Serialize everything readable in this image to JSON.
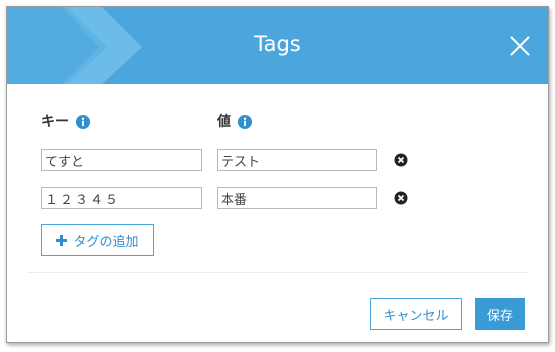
{
  "dialog": {
    "title": "Tags",
    "close_icon": "close-icon",
    "accent_color": "#4aa6dd"
  },
  "columns": {
    "key_label": "キー",
    "value_label": "値",
    "info_icon": "info-icon"
  },
  "rows": [
    {
      "key": "てすと",
      "value": "テスト",
      "remove_icon": "remove-icon"
    },
    {
      "key": "１２３４５",
      "value": "本番",
      "remove_icon": "remove-icon"
    }
  ],
  "add_tag": {
    "label": "タグの追加",
    "icon": "plus-icon"
  },
  "footer": {
    "cancel_label": "キャンセル",
    "save_label": "保存"
  }
}
